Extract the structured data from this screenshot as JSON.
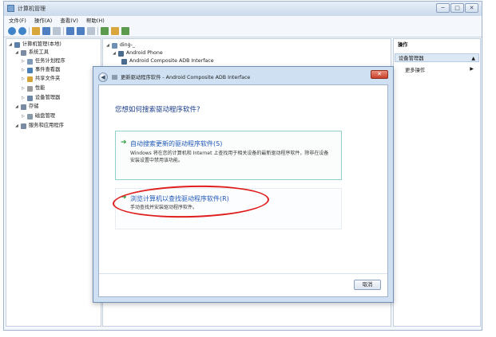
{
  "window": {
    "title": "计算机管理",
    "caption_buttons": [
      "─",
      "□",
      "✕"
    ]
  },
  "menu": [
    "文件(F)",
    "操作(A)",
    "查看(V)",
    "帮助(H)"
  ],
  "tree": [
    {
      "label": "计算机管理(本地)",
      "indent": 0,
      "icon_color": "#5b7fa8"
    },
    {
      "label": "系统工具",
      "indent": 1,
      "icon_color": "#7a8aa0"
    },
    {
      "label": "任务计划程序",
      "indent": 2,
      "icon_color": "#7f9bb8"
    },
    {
      "label": "事件查看器",
      "indent": 2,
      "icon_color": "#4a7fb8"
    },
    {
      "label": "共享文件夹",
      "indent": 2,
      "icon_color": "#d4a33a"
    },
    {
      "label": "性能",
      "indent": 2,
      "icon_color": "#9a9a9a"
    },
    {
      "label": "设备管理器",
      "indent": 2,
      "icon_color": "#6c87a6"
    },
    {
      "label": "存储",
      "indent": 1,
      "icon_color": "#7a8aa0"
    },
    {
      "label": "磁盘管理",
      "indent": 2,
      "icon_color": "#8899aa"
    },
    {
      "label": "服务和应用程序",
      "indent": 1,
      "icon_color": "#7a8aa0"
    }
  ],
  "devices": [
    {
      "label": "ding-_",
      "indent": 0
    },
    {
      "label": "Android Phone",
      "indent": 1
    },
    {
      "label": "Android Composite ADB Interface",
      "indent": 2
    }
  ],
  "actions": {
    "header": "操作",
    "selected": "设备管理器",
    "more": "更多操作"
  },
  "dialog": {
    "title": "更新驱动程序软件 - Android Composite ADB Interface",
    "question": "您想如何搜索驱动程序软件?",
    "option1": {
      "title": "自动搜索更新的驱动程序软件(S)",
      "description": "Windows 将在您的计算机和 Internet 上查找用于相关设备的最新驱动程序软件，除非在设备安装设置中禁用该功能。"
    },
    "option2": {
      "title": "浏览计算机以查找驱动程序软件(R)",
      "description": "手动查找并安装驱动程序软件。"
    },
    "cancel": "取消",
    "close": "✕",
    "back": "◀"
  },
  "colors": {
    "highlight_ellipse": "#e01d1d",
    "link_blue": "#1e57b8",
    "arrow_green": "#2b9b3b"
  }
}
